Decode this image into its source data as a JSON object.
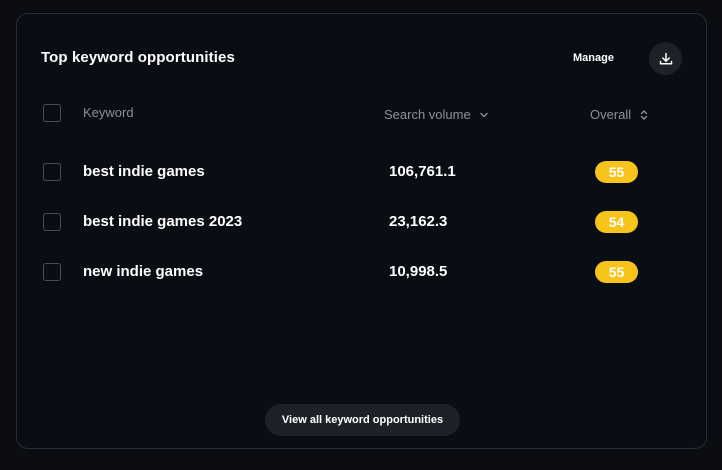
{
  "card": {
    "title": "Top keyword opportunities",
    "manage_label": "Manage",
    "download_icon": "download-icon"
  },
  "table": {
    "headers": {
      "keyword": "Keyword",
      "search_volume": "Search volume",
      "overall": "Overall"
    },
    "rows": [
      {
        "keyword": "best indie games",
        "search_volume": "106,761.1",
        "overall": "55"
      },
      {
        "keyword": "best indie games 2023",
        "search_volume": "23,162.3",
        "overall": "54"
      },
      {
        "keyword": "new indie games",
        "search_volume": "10,998.5",
        "overall": "55"
      }
    ]
  },
  "footer": {
    "view_all_label": "View all keyword opportunities"
  },
  "colors": {
    "background": "#0b0d13",
    "badge": "#f6c41b",
    "muted_text": "#8b8f9b",
    "button_bg": "#1f2129"
  }
}
